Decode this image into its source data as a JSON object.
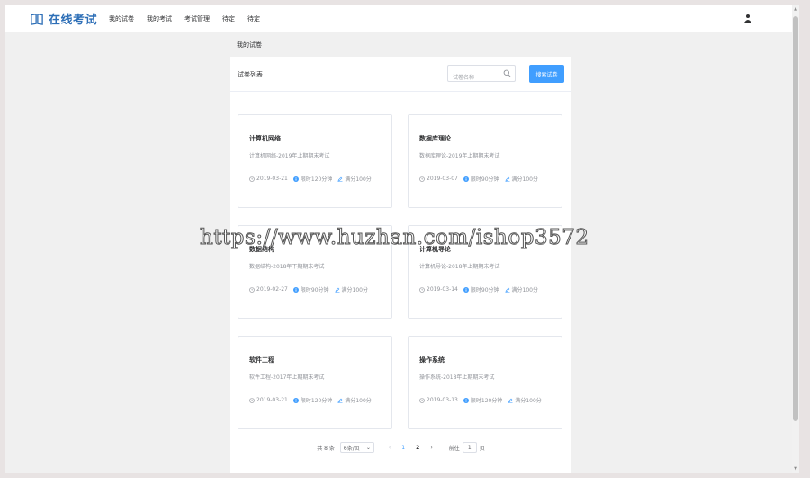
{
  "header": {
    "logo_text": "在线考试",
    "nav": [
      "我的试卷",
      "我的考试",
      "考试管理",
      "待定",
      "待定"
    ]
  },
  "breadcrumb": "我的试卷",
  "panel": {
    "title": "试卷列表",
    "search_placeholder": "试卷名称",
    "search_button": "搜索试卷"
  },
  "cards": [
    {
      "title": "计算机网络",
      "subtitle": "计算机网络-2019年上期期末考试",
      "date": "2019-03-21",
      "limit": "限时120分钟",
      "score": "满分100分"
    },
    {
      "title": "数据库理论",
      "subtitle": "数据库理论-2019年上期期末考试",
      "date": "2019-03-07",
      "limit": "限时90分钟",
      "score": "满分100分"
    },
    {
      "title": "数据结构",
      "subtitle": "数据结构-2018年下期期末考试",
      "date": "2019-02-27",
      "limit": "限时90分钟",
      "score": "满分100分"
    },
    {
      "title": "计算机导论",
      "subtitle": "计算机导论-2018年上期期末考试",
      "date": "2019-03-14",
      "limit": "限时90分钟",
      "score": "满分100分"
    },
    {
      "title": "软件工程",
      "subtitle": "软件工程-2017年上期期末考试",
      "date": "2019-03-21",
      "limit": "限时120分钟",
      "score": "满分100分"
    },
    {
      "title": "操作系统",
      "subtitle": "操作系统-2018年上期期末考试",
      "date": "2019-03-13",
      "limit": "限时120分钟",
      "score": "满分100分"
    }
  ],
  "pagination": {
    "total": "共 8 条",
    "page_size": "6条/页",
    "pages": [
      "1",
      "2"
    ],
    "goto_label": "前往",
    "goto_value": "1",
    "page_suffix": "页"
  },
  "watermark": "https://www.huzhan.com/ishop3572",
  "colors": {
    "primary": "#409eff",
    "logo": "#2e6fb7"
  }
}
